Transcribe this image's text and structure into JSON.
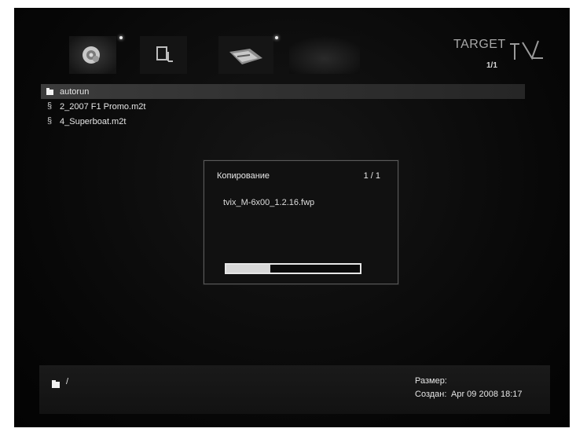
{
  "toolbar": {
    "icons": [
      "disc-icon",
      "memory-card-icon",
      "network-icon",
      "blank-slot"
    ]
  },
  "logo": {
    "text": "TARGET",
    "page_indicator": "1/1"
  },
  "file_list": [
    {
      "type": "folder",
      "name": "autorun",
      "selected": true
    },
    {
      "type": "video",
      "name": "2_2007 F1 Promo.m2t",
      "selected": false
    },
    {
      "type": "video",
      "name": "4_Superboat.m2t",
      "selected": false
    }
  ],
  "copy_dialog": {
    "title": "Копирование",
    "counter": "1 / 1",
    "filename": "tvix_M-6x00_1.2.16.fwp",
    "progress": 0.33
  },
  "status_bar": {
    "path": "/",
    "size_label": "Размер:",
    "size_value": "",
    "created_label": "Создан:",
    "created_value": "Apr 09 2008 18:17"
  },
  "colors": {
    "background": "#050505",
    "selection": "#363636",
    "text": "#e6e6e6",
    "dialog_border": "#5a5a5a"
  }
}
